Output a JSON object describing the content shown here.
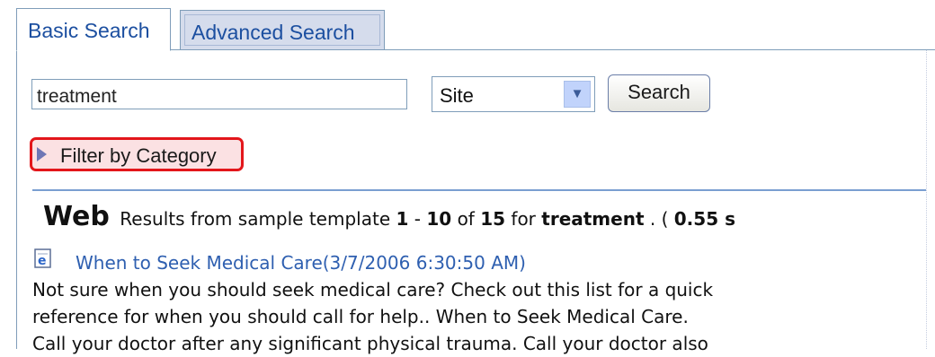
{
  "tabs": [
    {
      "label": "Basic Search",
      "active": true
    },
    {
      "label": "Advanced Search",
      "active": false
    }
  ],
  "search": {
    "query": "treatment",
    "scope_selected": "Site",
    "button_label": "Search"
  },
  "filter": {
    "label": "Filter by Category"
  },
  "results": {
    "heading": "Web",
    "source_text": "Results from sample template",
    "range_start": "1",
    "range_sep": "-",
    "range_end": "10",
    "of_text": "of",
    "total": "15",
    "for_text": "for",
    "term": "treatment",
    "paren_open": ". (",
    "time": "0.55 s",
    "items": [
      {
        "title": "When to Seek Medical Care(3/7/2006 6:30:50 AM)",
        "snippet_lines": [
          "Not sure when you should seek medical care? Check out this list for a quick",
          "reference for when you should call for help.. When to Seek Medical Care.",
          "Call your doctor after any significant physical trauma. Call your doctor also"
        ],
        "icon": "ie-page-icon"
      }
    ]
  },
  "colors": {
    "tab_text": "#1c4fa0",
    "link": "#2e5fb0",
    "highlight_border": "#e3161b",
    "highlight_fill": "#fbe1e3",
    "divider": "#7a9fd1"
  }
}
